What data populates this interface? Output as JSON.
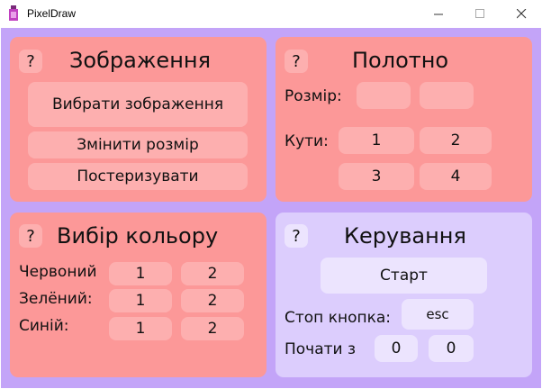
{
  "window": {
    "title": "PixelDraw"
  },
  "image_panel": {
    "help": "?",
    "title": "Зображення",
    "choose_image": "Вибрати зображення",
    "resize": "Змінити розмір",
    "posterize": "Постеризувати"
  },
  "canvas_panel": {
    "help": "?",
    "title": "Полотно",
    "size_label": "Розмір:",
    "size_values": [
      "",
      ""
    ],
    "corners_label": "Кути:",
    "corner_buttons": [
      "1",
      "2",
      "3",
      "4"
    ]
  },
  "color_panel": {
    "help": "?",
    "title": "Вибір кольору",
    "rows": [
      {
        "label": "Червоний",
        "btn1": "1",
        "btn2": "2"
      },
      {
        "label": "Зелёний:",
        "btn1": "1",
        "btn2": "2"
      },
      {
        "label": "Синій:",
        "btn1": "1",
        "btn2": "2"
      }
    ]
  },
  "control_panel": {
    "help": "?",
    "title": "Керування",
    "start": "Старт",
    "stop_label": "Стоп кнопка:",
    "stop_key": "esc",
    "start_from_label": "Почати з",
    "start_from_x": "0",
    "start_from_y": "0"
  },
  "colors": {
    "background": "#c3a4f8",
    "panel_red": "#fc9898",
    "panel_lilac": "#dccdfd",
    "button_red": "#fdafaf",
    "button_lilac": "#ece4fe"
  }
}
